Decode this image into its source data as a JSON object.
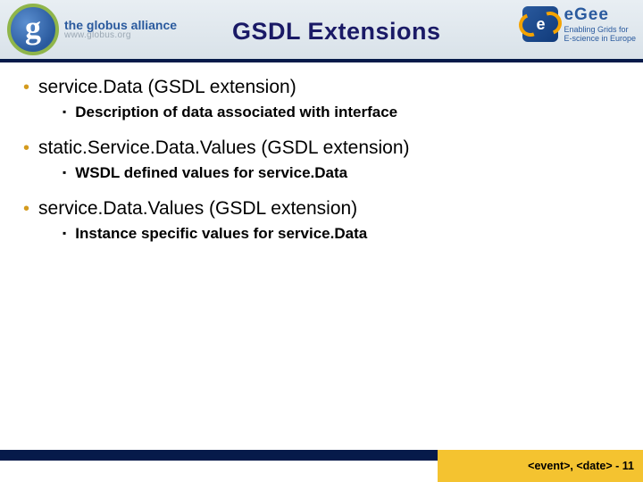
{
  "header": {
    "title": "GSDL Extensions",
    "globus": {
      "line1": "the globus alliance",
      "line2": "www.globus.org"
    },
    "egee": {
      "brand": "eGee",
      "tag1": "Enabling Grids for",
      "tag2": "E-science in Europe"
    }
  },
  "bullets": [
    {
      "text": "service.Data (GSDL extension)",
      "sub": "Description of data associated with interface"
    },
    {
      "text": "static.Service.Data.Values (GSDL extension)",
      "sub": "WSDL defined values for service.Data"
    },
    {
      "text": "service.Data.Values (GSDL extension)",
      "sub": "Instance specific values for service.Data"
    }
  ],
  "footer": {
    "meta": "<event>, <date>  -  11"
  }
}
